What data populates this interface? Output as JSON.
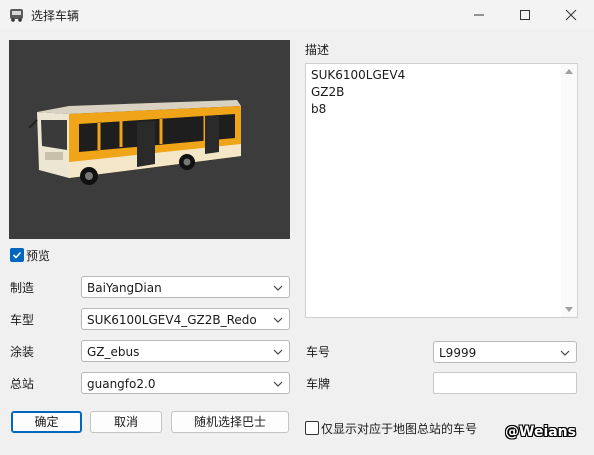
{
  "window": {
    "title": "选择车辆"
  },
  "preview_checkbox": {
    "label": "预览",
    "checked": true
  },
  "fields": {
    "manufacturer": {
      "label": "制造",
      "value": "BaiYangDian"
    },
    "model": {
      "label": "车型",
      "value": "SUK6100LGEV4_GZ2B_Redo"
    },
    "livery": {
      "label": "涂装",
      "value": "GZ_ebus"
    },
    "depot": {
      "label": "总站",
      "value": "guangfo2.0"
    }
  },
  "description": {
    "label": "描述",
    "lines": [
      "SUK6100LGEV4",
      "GZ2B",
      "b8"
    ]
  },
  "vehicle_number": {
    "label": "车号",
    "value": "L9999"
  },
  "plate": {
    "label": "车牌",
    "value": ""
  },
  "buttons": {
    "ok": "确定",
    "cancel": "取消",
    "random": "随机选择巴士"
  },
  "only_map_depot": {
    "label": "仅显示对应于地图总站的车号",
    "checked": false
  },
  "watermark": "@Weians",
  "colors": {
    "accent": "#0067c0",
    "preview_bg": "#3c3c3c",
    "bus_body": "#f0a418"
  }
}
